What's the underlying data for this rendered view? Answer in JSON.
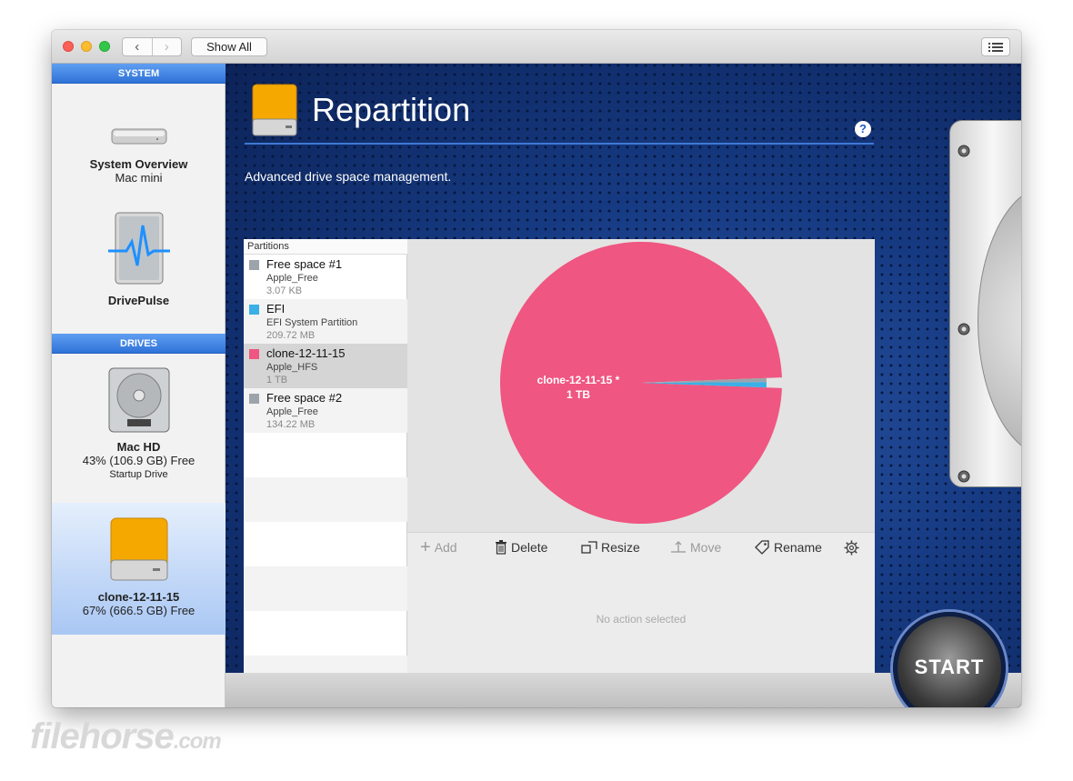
{
  "toolbar": {
    "back_icon": "chevron-left-icon",
    "forward_icon": "chevron-right-icon",
    "show_all_label": "Show All",
    "list_icon": "list-icon"
  },
  "sidebar": {
    "system_header": "SYSTEM",
    "drives_header": "DRIVES",
    "items": [
      {
        "title": "System Overview",
        "subtitle": "Mac mini",
        "icon": "mac-mini-icon"
      },
      {
        "title": "DrivePulse",
        "icon": "drivepulse-icon"
      }
    ],
    "drives": [
      {
        "title": "Mac HD",
        "subtitle": "43% (106.9 GB) Free",
        "note": "Startup Drive",
        "icon": "hard-drive-icon"
      },
      {
        "title": "clone-12-11-15",
        "subtitle": "67% (666.5 GB) Free",
        "icon": "external-drive-icon",
        "selected": true
      }
    ]
  },
  "main": {
    "title": "Repartition",
    "help_label": "?",
    "subtitle": "Advanced drive space management.",
    "partitions_header": "Partitions",
    "partitions": [
      {
        "name": "Free space #1",
        "type": "Apple_Free",
        "size": "3.07 KB",
        "color": "#9da3aa"
      },
      {
        "name": "EFI",
        "type": "EFI System Partition",
        "size": "209.72 MB",
        "color": "#3ab0e6"
      },
      {
        "name": "clone-12-11-15",
        "type": "Apple_HFS",
        "size": "1 TB",
        "color": "#ef5681"
      },
      {
        "name": "Free space #2",
        "type": "Apple_Free",
        "size": "134.22 MB",
        "color": "#9da3aa"
      }
    ],
    "actions": {
      "add": "Add",
      "delete": "Delete",
      "resize": "Resize",
      "move": "Move",
      "rename": "Rename"
    },
    "no_action_text": "No action selected",
    "start_label": "START"
  },
  "chart_data": {
    "type": "pie",
    "slice_label": "clone-12-11-15 *",
    "slice_value_label": "1 TB",
    "slices": [
      {
        "name": "clone-12-11-15",
        "fraction": 0.983,
        "color": "#ef5681"
      },
      {
        "name": "EFI",
        "fraction": 0.007,
        "color": "#3ab0e6"
      },
      {
        "name": "Free space #2",
        "fraction": 0.005,
        "color": "#9da3aa"
      }
    ]
  },
  "watermark": {
    "main": "filehorse",
    "suffix": ".com"
  }
}
